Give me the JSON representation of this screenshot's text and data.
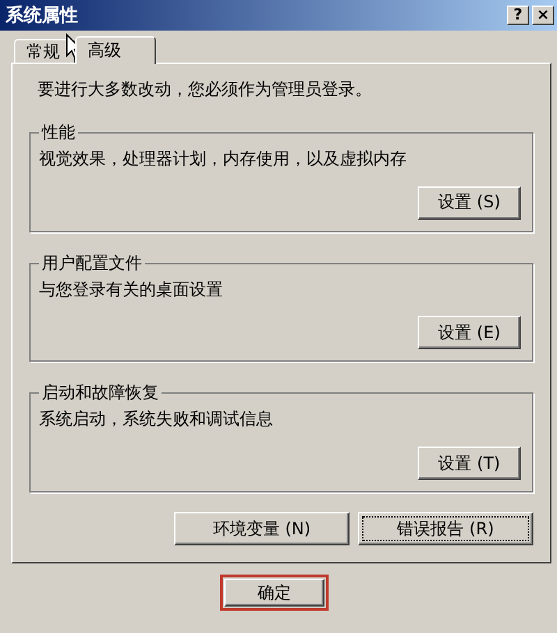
{
  "window": {
    "title": "系统属性",
    "help_button": "?",
    "close_button": "×"
  },
  "tabs": [
    {
      "label": "常规",
      "selected": false
    },
    {
      "label": "高级",
      "selected": true
    }
  ],
  "notice": "要进行大多数改动，您必须作为管理员登录。",
  "groups": [
    {
      "title": "性能",
      "description": "视觉效果，处理器计划，内存使用，以及虚拟内存",
      "button": "设置 (S)"
    },
    {
      "title": "用户配置文件",
      "description": "与您登录有关的桌面设置",
      "button": "设置 (E)"
    },
    {
      "title": "启动和故障恢复",
      "description": "系统启动，系统失败和调试信息",
      "button": "设置 (T)"
    }
  ],
  "extra_buttons": [
    {
      "label": "环境变量 (N)",
      "focused": false
    },
    {
      "label": "错误报告 (R)",
      "focused": true
    }
  ],
  "footer_buttons": [
    {
      "label": "确定",
      "highlighted": true
    }
  ]
}
